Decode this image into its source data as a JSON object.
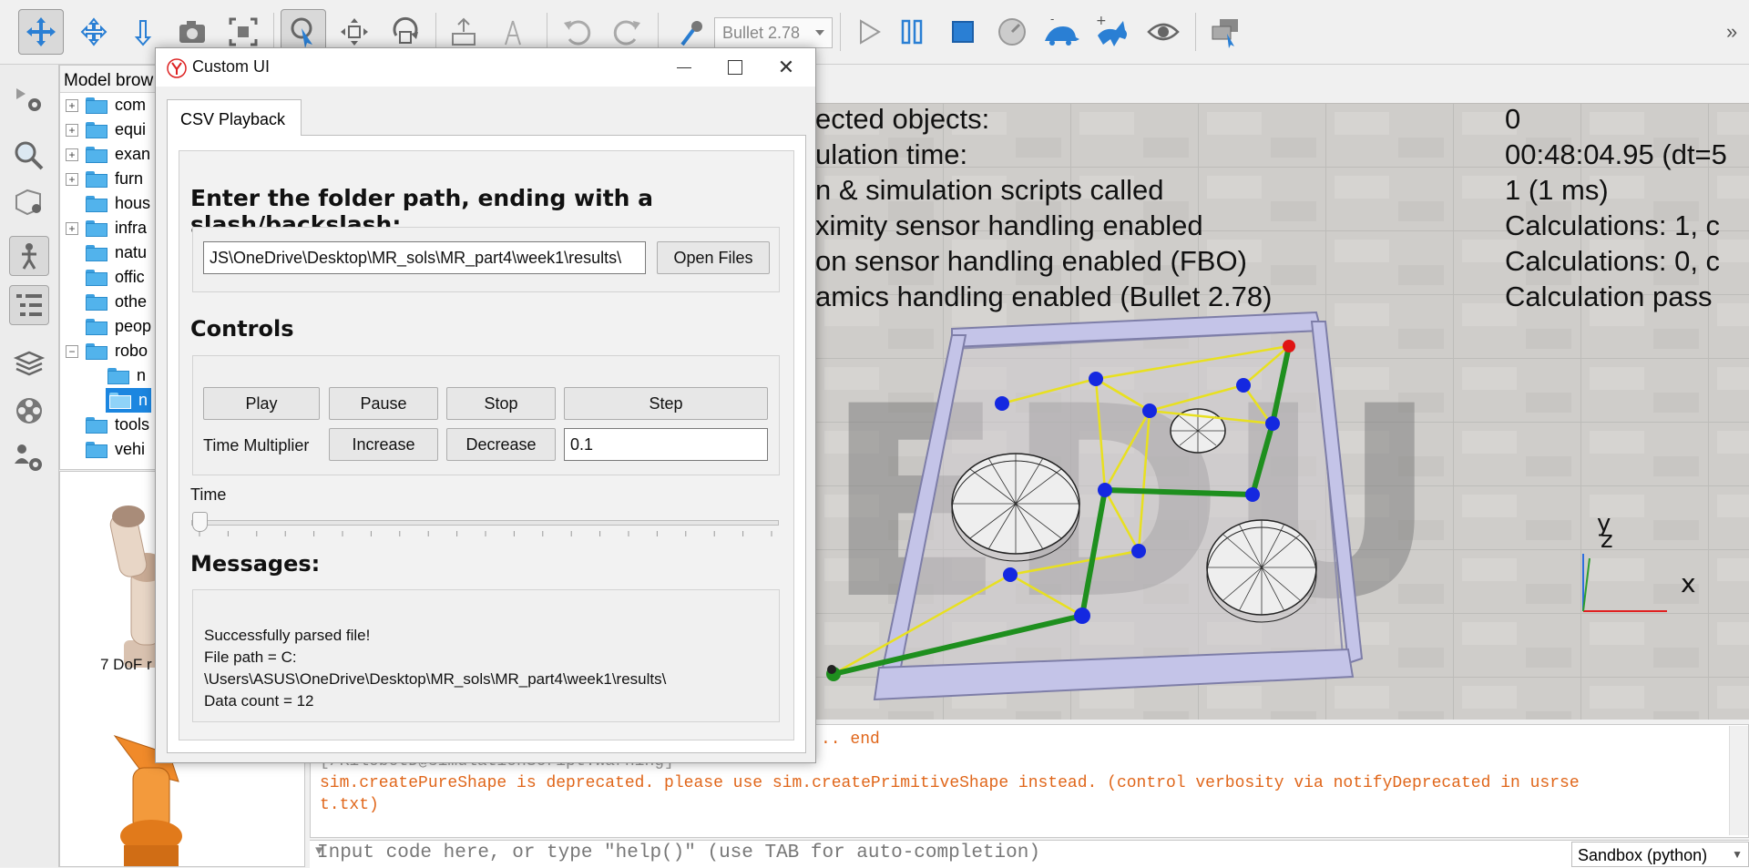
{
  "toolbar": {
    "engine_select": "Bullet 2.78",
    "overflow": "»"
  },
  "model_browser": {
    "title": "Model brow",
    "items": [
      {
        "label": "com",
        "expandable": true
      },
      {
        "label": "equi",
        "expandable": true
      },
      {
        "label": "exan",
        "expandable": true
      },
      {
        "label": "furn",
        "expandable": true
      },
      {
        "label": "hous",
        "expandable": false
      },
      {
        "label": "infra",
        "expandable": true
      },
      {
        "label": "natu",
        "expandable": false
      },
      {
        "label": "offic",
        "expandable": false
      },
      {
        "label": "othe",
        "expandable": false
      },
      {
        "label": "peop",
        "expandable": false
      },
      {
        "label": "robo",
        "expandable": true
      },
      {
        "label": "n",
        "expandable": false
      },
      {
        "label": "n",
        "expandable": false
      },
      {
        "label": "tools",
        "expandable": false
      },
      {
        "label": "vehi",
        "expandable": false
      }
    ],
    "preview_label": "7 DoF r"
  },
  "scene": {
    "info_rows": [
      {
        "label": "ected objects:",
        "value": "0"
      },
      {
        "label": "ulation time:",
        "value": "00:48:04.95 (dt=5"
      },
      {
        "label": "n & simulation scripts called",
        "value": "1 (1 ms)"
      },
      {
        "label": "ximity sensor handling enabled",
        "value": "Calculations: 1, c"
      },
      {
        "label": "on sensor handling enabled (FBO)",
        "value": "Calculations: 0, c"
      },
      {
        "label": "amics handling enabled (Bullet 2.78)",
        "value": "Calculation pass"
      }
    ],
    "watermark": "EDU",
    "axis_yz": "y\nz",
    "axis_x": "x"
  },
  "console": {
    "line1": ".. end",
    "line2": "[/KilobotD@simulationScript:warning]",
    "line3": "sim.createPureShape is deprecated. please use sim.createPrimitiveShape instead. (control verbosity via notifyDeprecated in usrse",
    "line4": "t.txt)",
    "input_placeholder": "Input code here, or type \"help()\" (use TAB for auto-completion)",
    "sandbox_select": "Sandbox (python)"
  },
  "dialog": {
    "title": "Custom UI",
    "tab_label": "CSV Playback",
    "folder_prompt": "Enter the folder path, ending with a slash/backslash:",
    "folder_path": "JS\\OneDrive\\Desktop\\MR_sols\\MR_part4\\week1\\results\\",
    "open_files": "Open Files",
    "controls_title": "Controls",
    "play": "Play",
    "pause": "Pause",
    "stop": "Stop",
    "step": "Step",
    "time_multiplier_label": "Time Multiplier",
    "increase": "Increase",
    "decrease": "Decrease",
    "time_multiplier_value": "0.1",
    "time_label": "Time",
    "time_slider_position": 0,
    "messages_title": "Messages:",
    "messages": [
      "Successfully parsed file!",
      "File path = C:",
      "\\Users\\ASUS\\OneDrive\\Desktop\\MR_sols\\MR_part4\\week1\\results\\",
      "Data count = 12"
    ]
  }
}
